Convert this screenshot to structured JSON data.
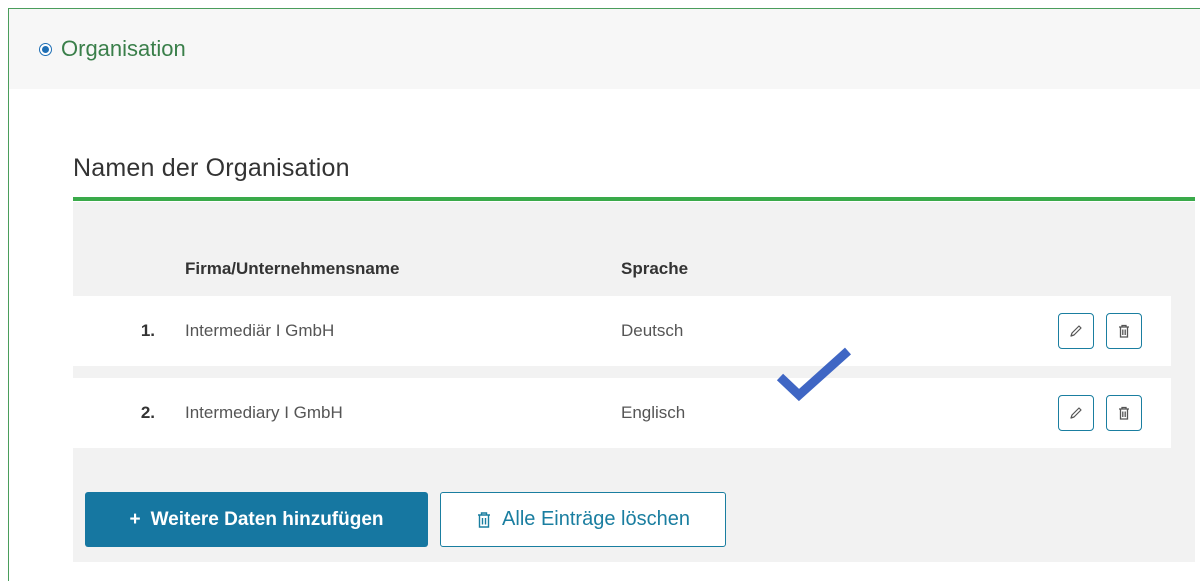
{
  "panel": {
    "title": "Organisation",
    "accent_color": "#3a7f4a",
    "radio_color": "#1f6fb5"
  },
  "section": {
    "title": "Namen der Organisation",
    "rule_color": "#3aaa4a"
  },
  "table": {
    "headers": [
      "Firma/Unternehmensname",
      "Sprache"
    ],
    "rows": [
      {
        "num": "1.",
        "name": "Intermediär I GmbH",
        "lang": "Deutsch"
      },
      {
        "num": "2.",
        "name": "Intermediary I GmbH",
        "lang": "Englisch"
      }
    ],
    "row_icons": [
      "pencil-icon",
      "trash-icon"
    ]
  },
  "actions": {
    "add_prefix": "+",
    "add_label": "Weitere Daten hinzufügen",
    "delete_all_label": "Alle Einträge löschen",
    "primary_color": "#1677a1"
  },
  "overlay": {
    "checkmark_icon": "checkmark-icon",
    "checkmark_color": "#3f66c4"
  }
}
